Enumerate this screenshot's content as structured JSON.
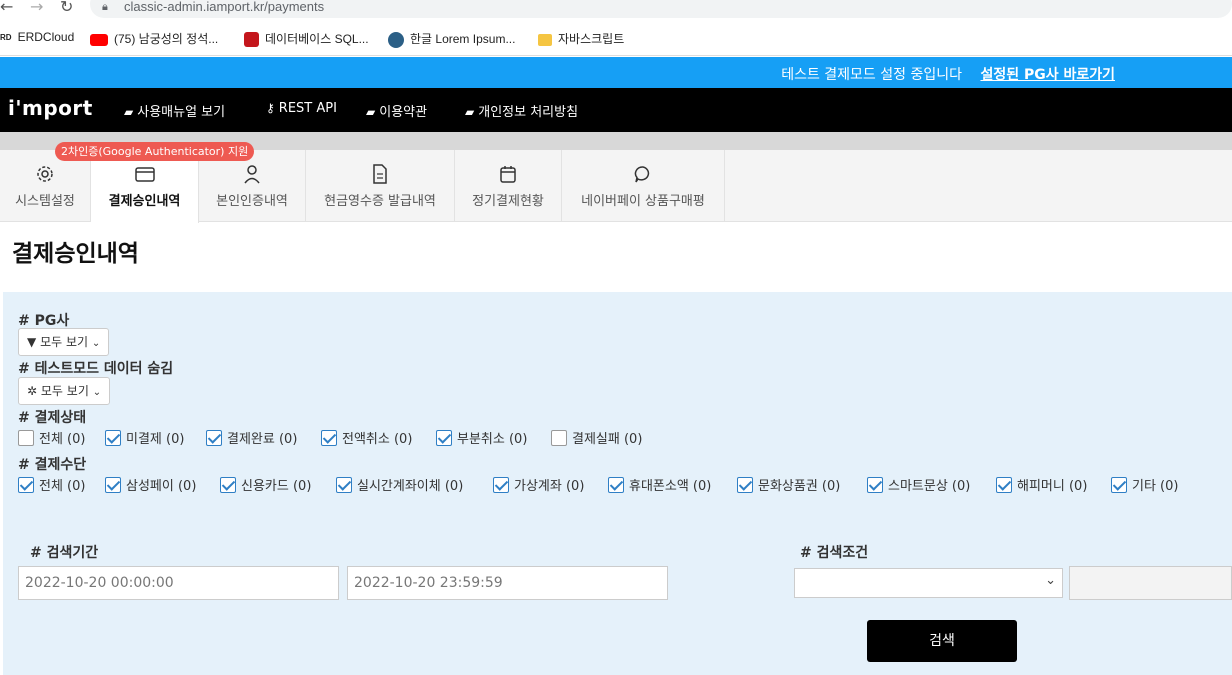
{
  "browser": {
    "url": "classic-admin.iamport.kr/payments",
    "bookmarks": [
      {
        "label": "ERDCloud"
      },
      {
        "label": "(75) 남궁성의 정석..."
      },
      {
        "label": "데이터베이스 SQL..."
      },
      {
        "label": "한글 Lorem Ipsum..."
      },
      {
        "label": "자바스크립트"
      }
    ]
  },
  "banner": {
    "message": "테스트 결제모드 설정 중입니다",
    "link": "설정된 PG사 바로가기",
    "color": "#169ff5"
  },
  "topnav": {
    "logo": "i'mport",
    "items": [
      {
        "label": "사용매뉴얼 보기",
        "icon": "book-icon"
      },
      {
        "label": "REST API",
        "icon": "key-icon"
      },
      {
        "label": "이용약관",
        "icon": "book-icon"
      },
      {
        "label": "개인정보 처리방침",
        "icon": "book-icon"
      }
    ]
  },
  "tabs": {
    "badge": "2차인증(Google Authenticator) 지원",
    "items": [
      {
        "label": "시스템설정",
        "icon": "gear-icon"
      },
      {
        "label": "결제승인내역",
        "icon": "card-icon",
        "active": true
      },
      {
        "label": "본인인증내역",
        "icon": "user-icon"
      },
      {
        "label": "현금영수증 발급내역",
        "icon": "document-icon"
      },
      {
        "label": "정기결제현황",
        "icon": "calendar-icon"
      },
      {
        "label": "네이버페이 상품구매평",
        "icon": "chat-icon"
      }
    ]
  },
  "page": {
    "title": "결제승인내역"
  },
  "filters": {
    "pg_label": "# PG사",
    "pg_dropdown": "모두 보기",
    "testmode_label": "# 테스트모드 데이터 숨김",
    "testmode_dropdown": "모두 보기",
    "status_label": "# 결제상태",
    "status": [
      {
        "label": "전체 (0)",
        "checked": false
      },
      {
        "label": "미결제 (0)",
        "checked": true
      },
      {
        "label": "결제완료 (0)",
        "checked": true
      },
      {
        "label": "전액취소 (0)",
        "checked": true
      },
      {
        "label": "부분취소 (0)",
        "checked": true
      },
      {
        "label": "결제실패 (0)",
        "checked": false
      }
    ],
    "method_label": "# 결제수단",
    "methods": [
      {
        "label": "전체 (0)",
        "checked": true
      },
      {
        "label": "삼성페이 (0)",
        "checked": true
      },
      {
        "label": "신용카드 (0)",
        "checked": true
      },
      {
        "label": "실시간계좌이체 (0)",
        "checked": true
      },
      {
        "label": "가상계좌 (0)",
        "checked": true
      },
      {
        "label": "휴대폰소액 (0)",
        "checked": true
      },
      {
        "label": "문화상품권 (0)",
        "checked": true
      },
      {
        "label": "스마트문상 (0)",
        "checked": true
      },
      {
        "label": "해피머니 (0)",
        "checked": true
      },
      {
        "label": "기타 (0)",
        "checked": true
      }
    ],
    "period_label": "# 검색기간",
    "period_start": "2022-10-20 00:00:00",
    "period_end": "2022-10-20 23:59:59",
    "condition_label": "# 검색조건",
    "condition_value": "",
    "search_button": "검색"
  }
}
